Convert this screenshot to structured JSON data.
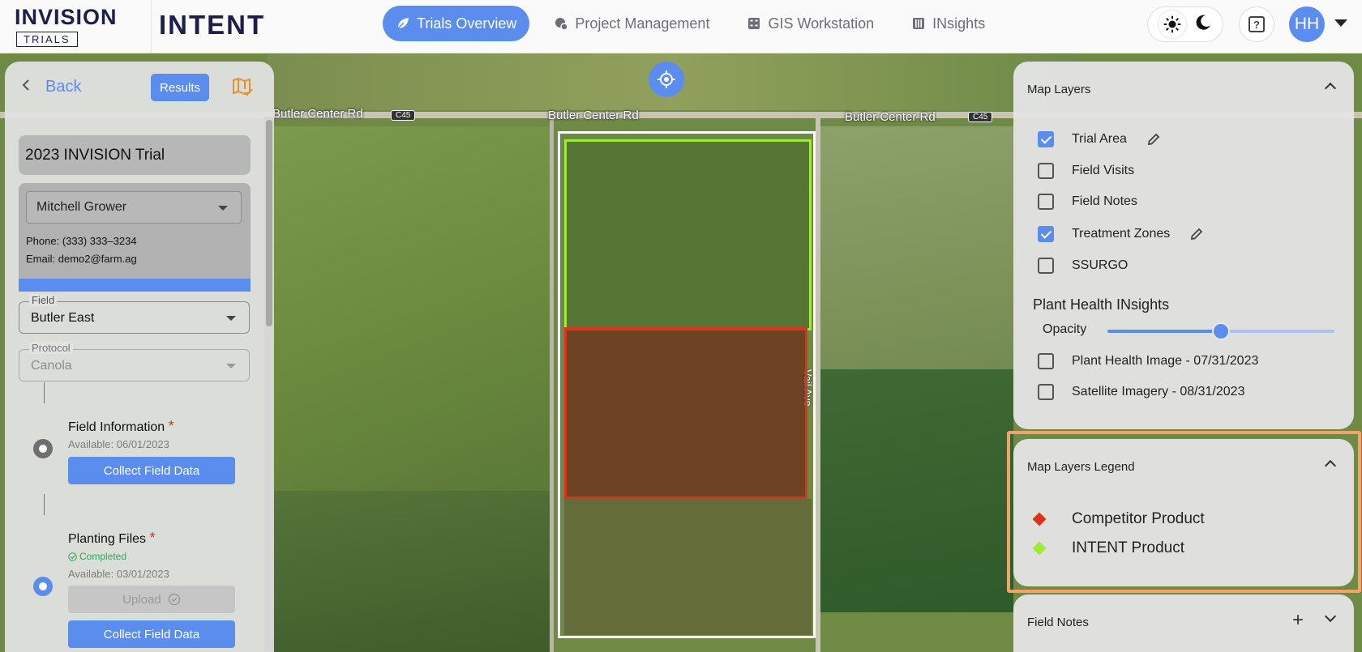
{
  "header": {
    "logo_top": "INVISION",
    "logo_sub": "TRIALS",
    "logo_main": "INTENT",
    "nav": [
      {
        "label": "Trials Overview",
        "icon": "leaf-icon",
        "active": true
      },
      {
        "label": "Project Management",
        "icon": "cog-box-icon",
        "active": false
      },
      {
        "label": "GIS Workstation",
        "icon": "calculator-icon",
        "active": false
      },
      {
        "label": "INsights",
        "icon": "sliders-icon",
        "active": false
      }
    ],
    "avatar_initials": "HH",
    "help_glyph": "?"
  },
  "map": {
    "roads": [
      "Butler Center Rd",
      "Butler Center Rd",
      "Butler Center Rd"
    ],
    "road_shield": "C45",
    "road_vertical": "Vail Ave"
  },
  "left_panel": {
    "back_label": "Back",
    "results_label": "Results",
    "trial_name": "2023 INVISION Trial",
    "grower": "Mitchell Grower",
    "phone": "Phone: (333) 333–3234",
    "email": "Email: demo2@farm.ag",
    "field_label": "Field",
    "field_value": "Butler East",
    "protocol_label": "Protocol",
    "protocol_value": "Canola",
    "steps": [
      {
        "title": "Field Information",
        "required": "*",
        "available": "Available: 06/01/2023",
        "button": "Collect Field Data"
      },
      {
        "title": "Planting Files",
        "required": "*",
        "status": "Completed",
        "available": "Available: 03/01/2023",
        "upload": "Upload",
        "button": "Collect Field Data"
      }
    ]
  },
  "layers": {
    "title": "Map Layers",
    "items": [
      {
        "label": "Trial Area",
        "checked": true,
        "editable": true
      },
      {
        "label": "Field Visits",
        "checked": false
      },
      {
        "label": "Field Notes",
        "checked": false
      },
      {
        "label": "Treatment Zones",
        "checked": true,
        "editable": true
      },
      {
        "label": "SSURGO",
        "checked": false
      }
    ],
    "insights_title": "Plant Health INsights",
    "opacity_label": "Opacity",
    "opacity_value": 0.5,
    "images": [
      {
        "label": "Plant Health Image - 07/31/2023",
        "checked": false
      },
      {
        "label": "Satellite Imagery - 08/31/2023",
        "checked": false
      }
    ]
  },
  "legend": {
    "title": "Map Layers Legend",
    "items": [
      {
        "label": "Competitor Product",
        "color": "#e0311f"
      },
      {
        "label": "INTENT Product",
        "color": "#9eea3a"
      }
    ]
  },
  "notes": {
    "title": "Field Notes"
  },
  "colors": {
    "accent": "#5b8def",
    "highlight": "#f4a26b"
  }
}
